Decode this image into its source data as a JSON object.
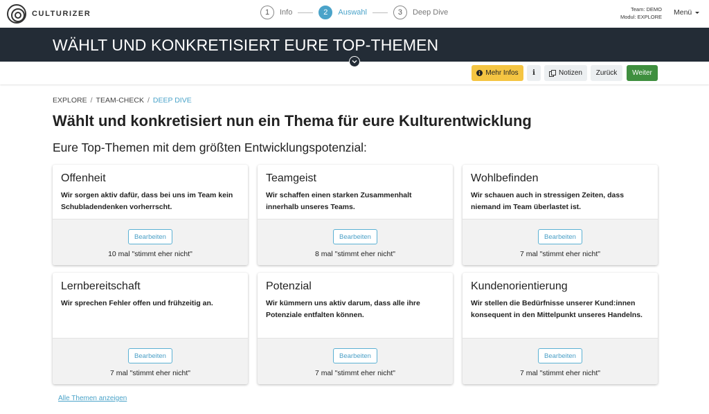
{
  "brand": {
    "name": "CULTURIZER"
  },
  "stepper": [
    {
      "num": "1",
      "label": "Info"
    },
    {
      "num": "2",
      "label": "Auswahl"
    },
    {
      "num": "3",
      "label": "Deep Dive"
    }
  ],
  "team": {
    "team_line": "Team: DEMO",
    "module_line": "Modul: EXPLORE"
  },
  "menu": {
    "label": "Menü"
  },
  "band": {
    "title": "WÄHLT UND KONKRETISIERT EURE TOP-THEMEN"
  },
  "toolbar": {
    "info_label": "Mehr Infos",
    "i_label": "i",
    "notes_label": "Notizen",
    "back_label": "Zurück",
    "next_label": "Weiter"
  },
  "breadcrumb": [
    "EXPLORE",
    "TEAM-CHECK",
    "DEEP DIVE"
  ],
  "page": {
    "title": "Wählt und konkretisiert nun ein Thema für eure Kulturentwicklung",
    "subtitle": "Eure Top-Themen mit dem größten Entwicklungspotenzial:"
  },
  "cards": [
    {
      "title": "Offenheit",
      "desc": "Wir sorgen aktiv dafür, dass bei uns im Team kein Schubladendenken vorherrscht.",
      "edit_label": "Bearbeiten",
      "count": "10 mal \"stimmt eher nicht\""
    },
    {
      "title": "Teamgeist",
      "desc": "Wir schaffen einen starken Zusammenhalt innerhalb unseres Teams.",
      "edit_label": "Bearbeiten",
      "count": "8 mal \"stimmt eher nicht\""
    },
    {
      "title": "Wohlbefinden",
      "desc": "Wir schauen auch in stressigen Zeiten, dass niemand im Team überlastet ist.",
      "edit_label": "Bearbeiten",
      "count": "7 mal \"stimmt eher nicht\""
    },
    {
      "title": "Lernbereitschaft",
      "desc": "Wir sprechen Fehler offen und frühzeitig an.",
      "edit_label": "Bearbeiten",
      "count": "7 mal \"stimmt eher nicht\""
    },
    {
      "title": "Potenzial",
      "desc": "Wir kümmern uns aktiv darum, dass alle ihre Potenziale entfalten können.",
      "edit_label": "Bearbeiten",
      "count": "7 mal \"stimmt eher nicht\""
    },
    {
      "title": "Kundenorientierung",
      "desc": "Wir stellen die Bedürfnisse unserer Kund:innen konsequent in den Mittelpunkt unseres Handelns.",
      "edit_label": "Bearbeiten",
      "count": "7 mal \"stimmt eher nicht\""
    }
  ],
  "show_all": {
    "label": "Alle Themen anzeigen"
  },
  "colors": {
    "band": "#232c36",
    "accent": "#4aa3c9",
    "warning": "#f5c542",
    "success": "#3f8f3f"
  }
}
